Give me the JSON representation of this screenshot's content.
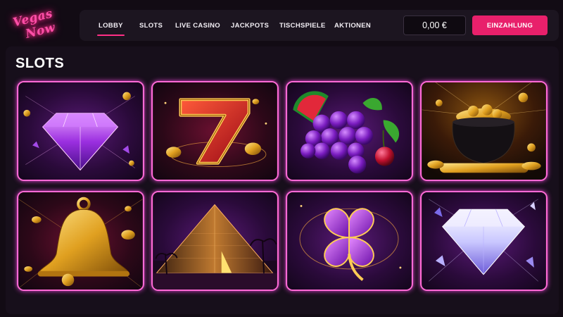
{
  "brand": {
    "line1": "Vegas",
    "line2": "Now"
  },
  "nav": {
    "items": [
      {
        "label": "LOBBY"
      },
      {
        "label": "SLOTS"
      },
      {
        "label": "LIVE CASINO"
      },
      {
        "label": "JACKPOTS"
      },
      {
        "label": "TISCHSPIELE"
      },
      {
        "label": "AKTIONEN"
      }
    ],
    "active": "LOBBY"
  },
  "account": {
    "balance": "0,00 €",
    "deposit_label": "EINZAHLUNG"
  },
  "page": {
    "title": "SLOTS"
  },
  "games": [
    {
      "icon": "purple-diamond-icon"
    },
    {
      "icon": "lucky-seven-icon"
    },
    {
      "icon": "grapes-fruit-icon"
    },
    {
      "icon": "pot-of-gold-icon"
    },
    {
      "icon": "golden-bell-icon"
    },
    {
      "icon": "pyramid-icon"
    },
    {
      "icon": "four-leaf-clover-icon"
    },
    {
      "icon": "white-diamond-icon"
    }
  ],
  "colors": {
    "accent": "#e8206b",
    "tile_border": "#ff6ad6",
    "background": "#120b14",
    "panel": "#1c1520"
  }
}
